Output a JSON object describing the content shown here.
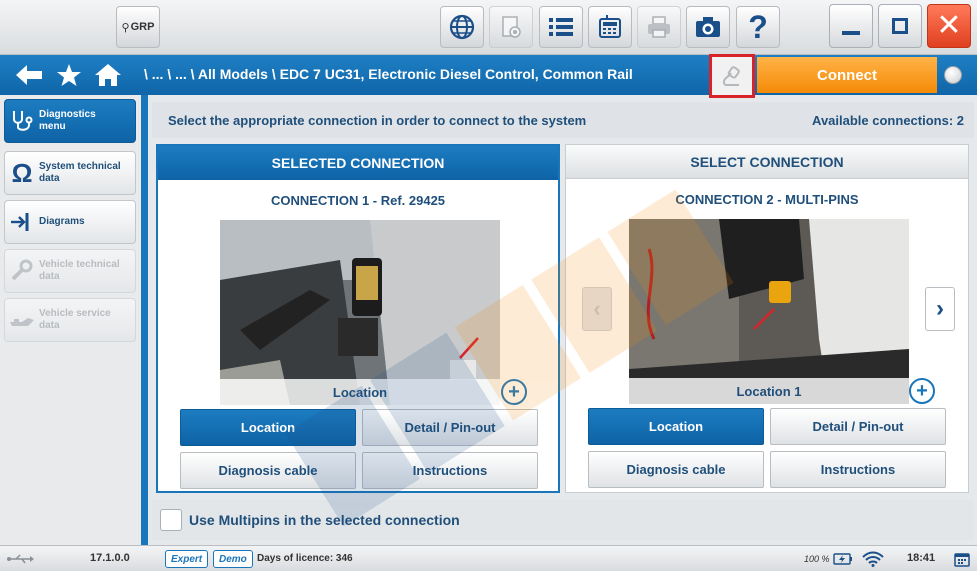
{
  "toolbar": {
    "grp_label": "GRP",
    "icons": [
      "globe-icon",
      "eye-doc-icon",
      "list-icon",
      "calculator-icon",
      "printer-icon",
      "camera-icon",
      "help-icon"
    ],
    "window": [
      "minimize-icon",
      "maximize-icon",
      "close-icon"
    ]
  },
  "nav": {
    "breadcrumb": "\\ ... \\ ... \\ All Models \\ EDC 7 UC31, Electronic Diesel Control, Common Rail",
    "connect_label": "Connect"
  },
  "sidebar": {
    "items": [
      {
        "label": "Diagnostics menu",
        "icon": "stethoscope-icon",
        "state": "active"
      },
      {
        "label": "System technical data",
        "icon": "omega-icon",
        "state": "normal"
      },
      {
        "label": "Diagrams",
        "icon": "diagram-icon",
        "state": "normal"
      },
      {
        "label": "Vehicle technical data",
        "icon": "wrench-icon",
        "state": "disabled"
      },
      {
        "label": "Vehicle service data",
        "icon": "oil-can-icon",
        "state": "disabled"
      }
    ]
  },
  "main": {
    "instruction": "Select the appropriate connection in order to connect to the system",
    "available": "Available connections: 2",
    "panels": [
      {
        "header": "SELECTED CONNECTION",
        "title": "CONNECTION 1 - Ref. 29425",
        "caption": "Location",
        "buttons": [
          "Location",
          "Detail / Pin-out",
          "Diagnosis cable",
          "Instructions"
        ]
      },
      {
        "header": "SELECT CONNECTION",
        "title": "CONNECTION 2 - MULTI-PINS",
        "caption": "Location 1",
        "buttons": [
          "Location",
          "Detail / Pin-out",
          "Diagnosis cable",
          "Instructions"
        ]
      }
    ],
    "multipins_label": "Use Multipins in the selected connection"
  },
  "statusbar": {
    "version": "17.1.0.0",
    "expert": "Expert",
    "demo": "Demo",
    "licence": "Days of licence: 346",
    "battery": "100 %",
    "time": "18:41"
  },
  "colors": {
    "accent": "#1a76ba",
    "connect": "#f58a07",
    "highlight": "#d8232a"
  }
}
